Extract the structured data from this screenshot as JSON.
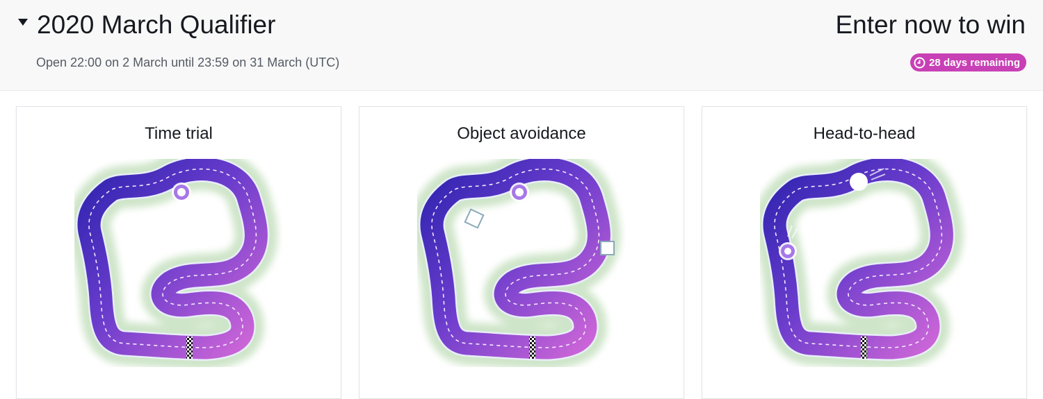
{
  "header": {
    "title": "2020 March Qualifier",
    "subtitle": "Open 22:00 on 2 March until 23:59 on 31 March (UTC)",
    "cta": "Enter now to win",
    "badge": "28 days remaining",
    "badge_icon": "clock-icon",
    "caret_icon": "caret-down-icon"
  },
  "cards": [
    {
      "title": "Time trial"
    },
    {
      "title": "Object avoidance"
    },
    {
      "title": "Head-to-head"
    }
  ],
  "colors": {
    "track_start": "#3f2dbd",
    "track_end": "#cc5fd6",
    "badge": "#c840b5",
    "glow": "#d6ead1"
  }
}
